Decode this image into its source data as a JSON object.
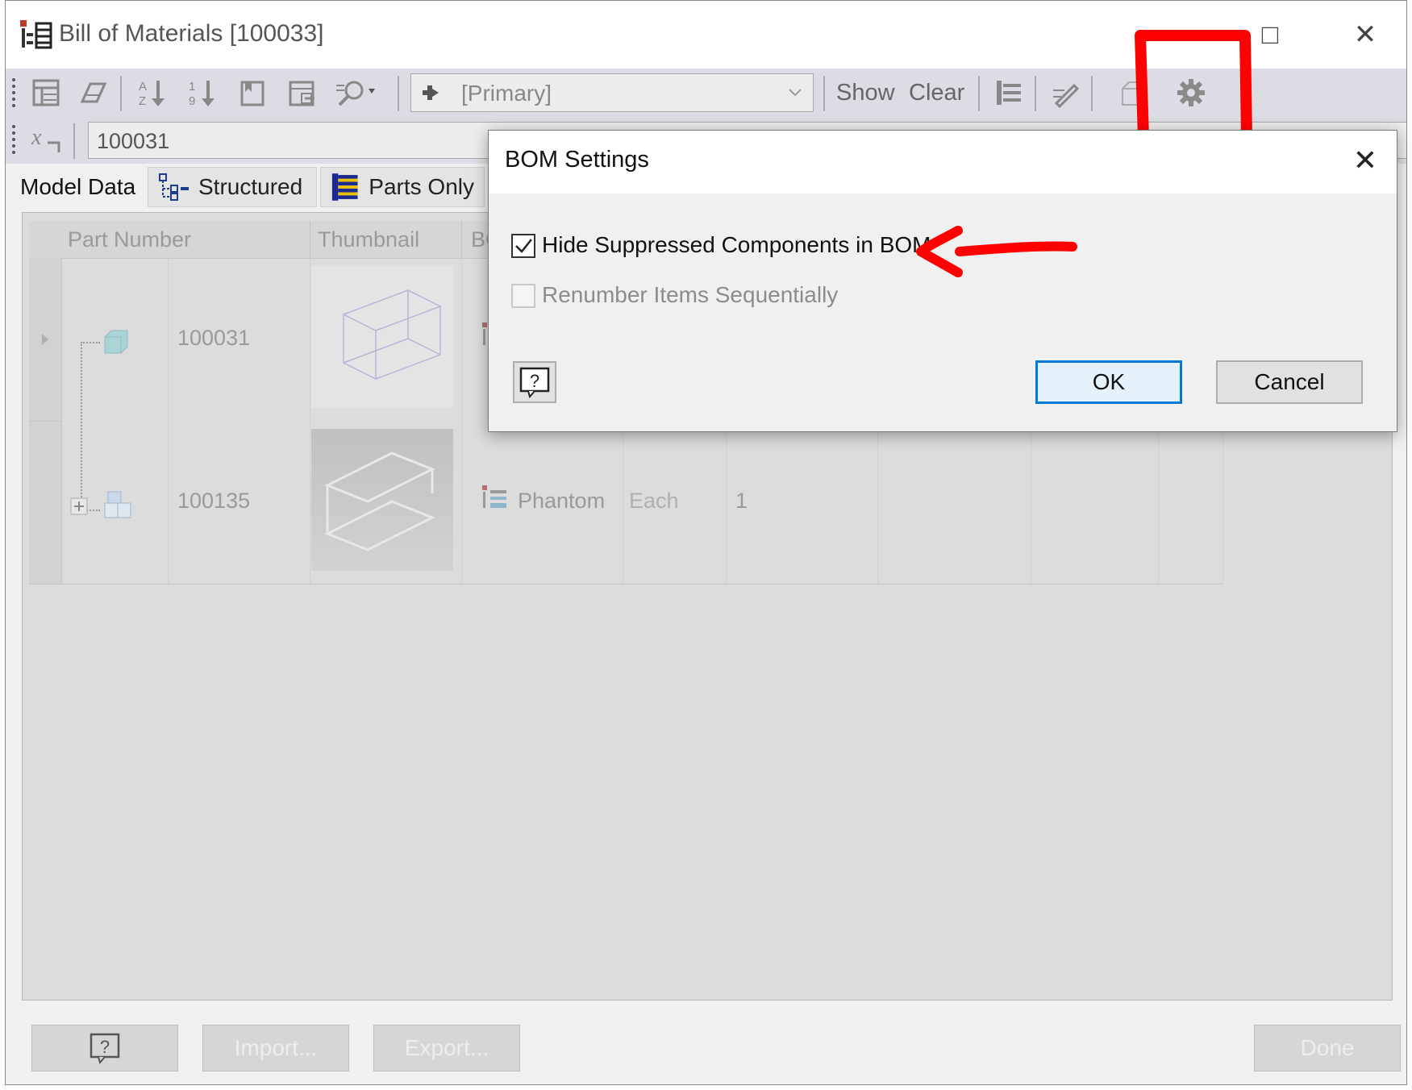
{
  "window": {
    "title": "Bill of Materials [100033]",
    "app_icon": "bom-icon",
    "controls": {
      "maximize": "□",
      "close": "✕"
    }
  },
  "toolbar": {
    "view_combo": "[Primary]",
    "show_label": "Show",
    "clear_label": "Clear",
    "icons": [
      "bom-table-icon",
      "eraser-icon",
      "sort-ascending-icon",
      "sort-descending-icon",
      "bookmark-icon",
      "export-table-icon",
      "find-icon",
      "bom-structure-icon",
      "edit-icon",
      "box-icon",
      "settings-gear-icon"
    ]
  },
  "toolbar2": {
    "expression_icon": "x-subscript-icon",
    "value": "100031"
  },
  "tabs": [
    {
      "label": "Model Data",
      "active": true
    },
    {
      "label": "Structured",
      "icon": "structured-tree-icon",
      "active": false
    },
    {
      "label": "Parts Only",
      "icon": "parts-list-icon",
      "active": false
    }
  ],
  "grid": {
    "columns": [
      "Part Number",
      "Thumbnail",
      "BC"
    ],
    "rows": [
      {
        "part_number": "100031",
        "bom_structure": "",
        "unit": "",
        "qty": ""
      },
      {
        "part_number": "100135",
        "bom_structure": "Phantom",
        "unit": "Each",
        "qty": "1"
      }
    ]
  },
  "bottom_buttons": {
    "help": "?",
    "import": "Import...",
    "export": "Export...",
    "done": "Done"
  },
  "dialog": {
    "title": "BOM Settings",
    "close": "✕",
    "options": [
      {
        "label": "Hide Suppressed Components in BOM",
        "checked": true,
        "enabled": true
      },
      {
        "label": "Renumber Items Sequentially",
        "checked": false,
        "enabled": false
      }
    ],
    "help": "?",
    "ok": "OK",
    "cancel": "Cancel"
  },
  "colors": {
    "annotation_red": "#ff0000",
    "ok_focus_blue": "#0078d7",
    "toolbar_bg": "#dcdce4"
  }
}
